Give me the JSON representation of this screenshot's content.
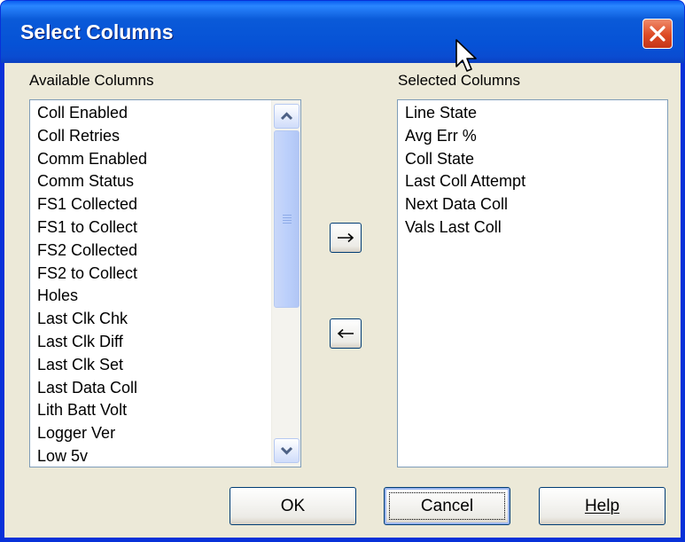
{
  "window": {
    "title": "Select Columns"
  },
  "available": {
    "label": "Available Columns",
    "items": [
      "Coll Enabled",
      "Coll Retries",
      "Comm Enabled",
      "Comm Status",
      "FS1 Collected",
      "FS1 to Collect",
      "FS2 Collected",
      "FS2 to Collect",
      "Holes",
      "Last Clk Chk",
      "Last Clk Diff",
      "Last Clk Set",
      "Last Data Coll",
      "Lith Batt Volt",
      "Logger Ver",
      "Low 5v"
    ]
  },
  "selected": {
    "label": "Selected Columns",
    "items": [
      "Line State",
      "Avg Err %",
      "Coll State",
      "Last Coll Attempt",
      "Next Data Coll",
      "Vals Last Coll"
    ]
  },
  "buttons": {
    "add_label": "→",
    "remove_label": "←",
    "ok_label": "OK",
    "cancel_label": "Cancel",
    "help_label": "Help"
  },
  "icons": {
    "close": "close-icon",
    "scroll_up": "chevron-up-icon",
    "scroll_down": "chevron-down-icon",
    "cursor": "mouse-cursor-icon"
  },
  "colors": {
    "titlebar": "#0a5ad8",
    "client": "#ece9d8",
    "close_button": "#dd4a25",
    "list_border": "#7f9db9"
  }
}
